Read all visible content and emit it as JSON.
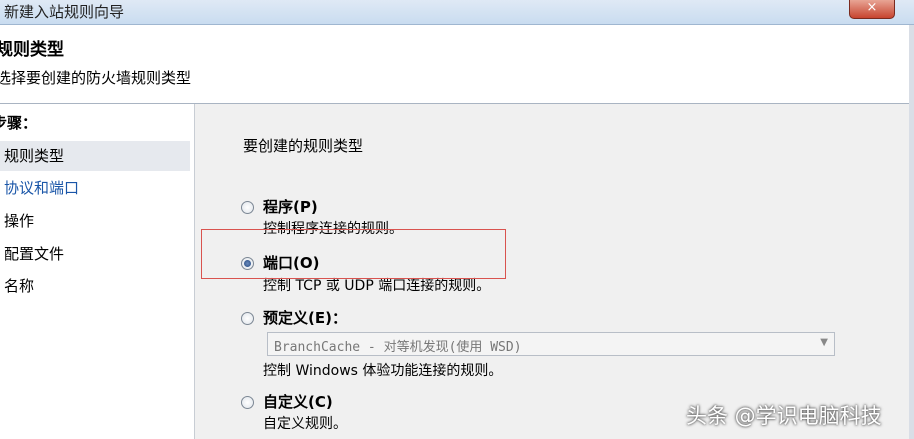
{
  "window": {
    "title": "新建入站规则向导",
    "close_glyph": "×"
  },
  "header": {
    "title": "规则类型",
    "subtitle": "选择要创建的防火墙规则类型"
  },
  "steps": {
    "heading": "步骤：",
    "items": [
      "规则类型",
      "协议和端口",
      "操作",
      "配置文件",
      "名称"
    ]
  },
  "main": {
    "prompt": "要创建的规则类型",
    "options": [
      {
        "label": "程序(P)",
        "desc": "控制程序连接的规则。",
        "checked": false
      },
      {
        "label": "端口(O)",
        "desc": "控制 TCP 或 UDP 端口连接的规则。",
        "checked": true
      },
      {
        "label": "预定义(E)：",
        "desc": "控制 Windows 体验功能连接的规则。",
        "checked": false
      },
      {
        "label": "自定义(C)",
        "desc": "自定义规则。",
        "checked": false
      }
    ],
    "predefined_select": {
      "value": "BranchCache - 对等机发现(使用 WSD)"
    }
  },
  "watermark": "头条 @学识电脑科技"
}
